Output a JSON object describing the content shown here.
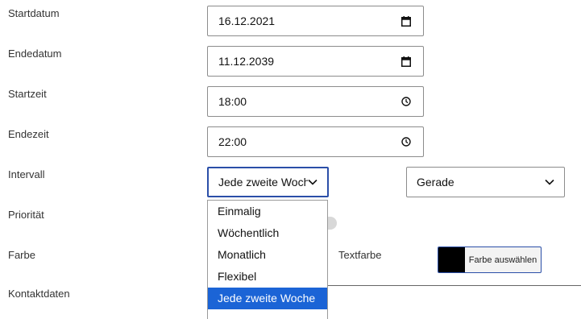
{
  "labels": {
    "start_date": "Startdatum",
    "end_date": "Endedatum",
    "start_time": "Startzeit",
    "end_time": "Endezeit",
    "interval": "Intervall",
    "priority": "Priorität",
    "color": "Farbe",
    "text_color": "Textfarbe",
    "contact": "Kontaktdaten"
  },
  "fields": {
    "start_date": "16.12.2021",
    "end_date": "11.12.2039",
    "start_time": "18:00",
    "end_time": "22:00"
  },
  "interval": {
    "selected": "Jede zweite Woche",
    "options": [
      "Einmalig",
      "Wöchentlich",
      "Monatlich",
      "Flexibel",
      "Jede zweite Woche"
    ]
  },
  "parity": {
    "selected": "Gerade"
  },
  "color_picker": {
    "button_label": "Farbe auswählen",
    "swatch_color": "#000000"
  },
  "colors": {
    "focus": "#2b4fa8",
    "highlight": "#1b64d6"
  },
  "icons": {
    "date": "calendar-icon",
    "time": "clock-icon",
    "select": "chevron-down-icon"
  }
}
